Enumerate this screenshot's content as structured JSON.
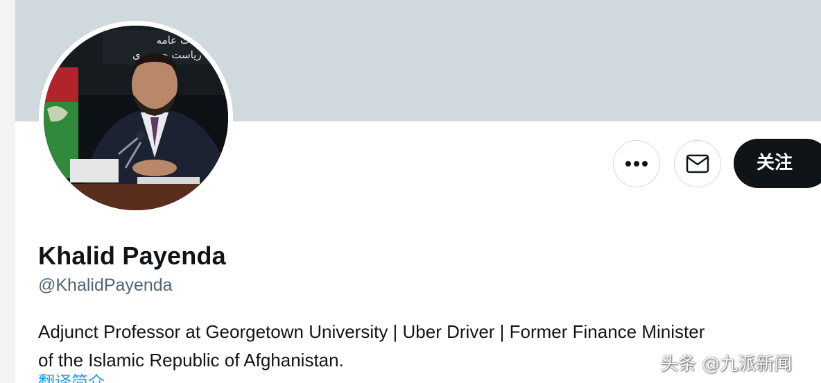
{
  "profile": {
    "display_name": "Khalid Payenda",
    "handle": "@KhalidPayenda",
    "bio_lines": [
      "Adjunct Professor at Georgetown University | Uber Driver | Former Finance Minister",
      "of the Islamic Republic of Afghanistan."
    ],
    "avatar_caption_line1": "ﺎﻃﻼﻋﺎﺕ ﻋﺎﻣﻪ",
    "avatar_caption_line2": "ﯾﮏ ﺭﯾﺎﺳﺖ ﺟﻤﻬﻮﺭﯼ"
  },
  "actions": {
    "more_icon": "more-icon",
    "message_icon": "mail-icon",
    "follow_label": "关注"
  },
  "partial_link_text": "翻译简介",
  "watermark": "头条 @九派新闻",
  "colors": {
    "banner": "#cfd9de",
    "follow_bg": "#0f1419",
    "secondary_text": "#536471",
    "link": "#1d9bf0"
  }
}
